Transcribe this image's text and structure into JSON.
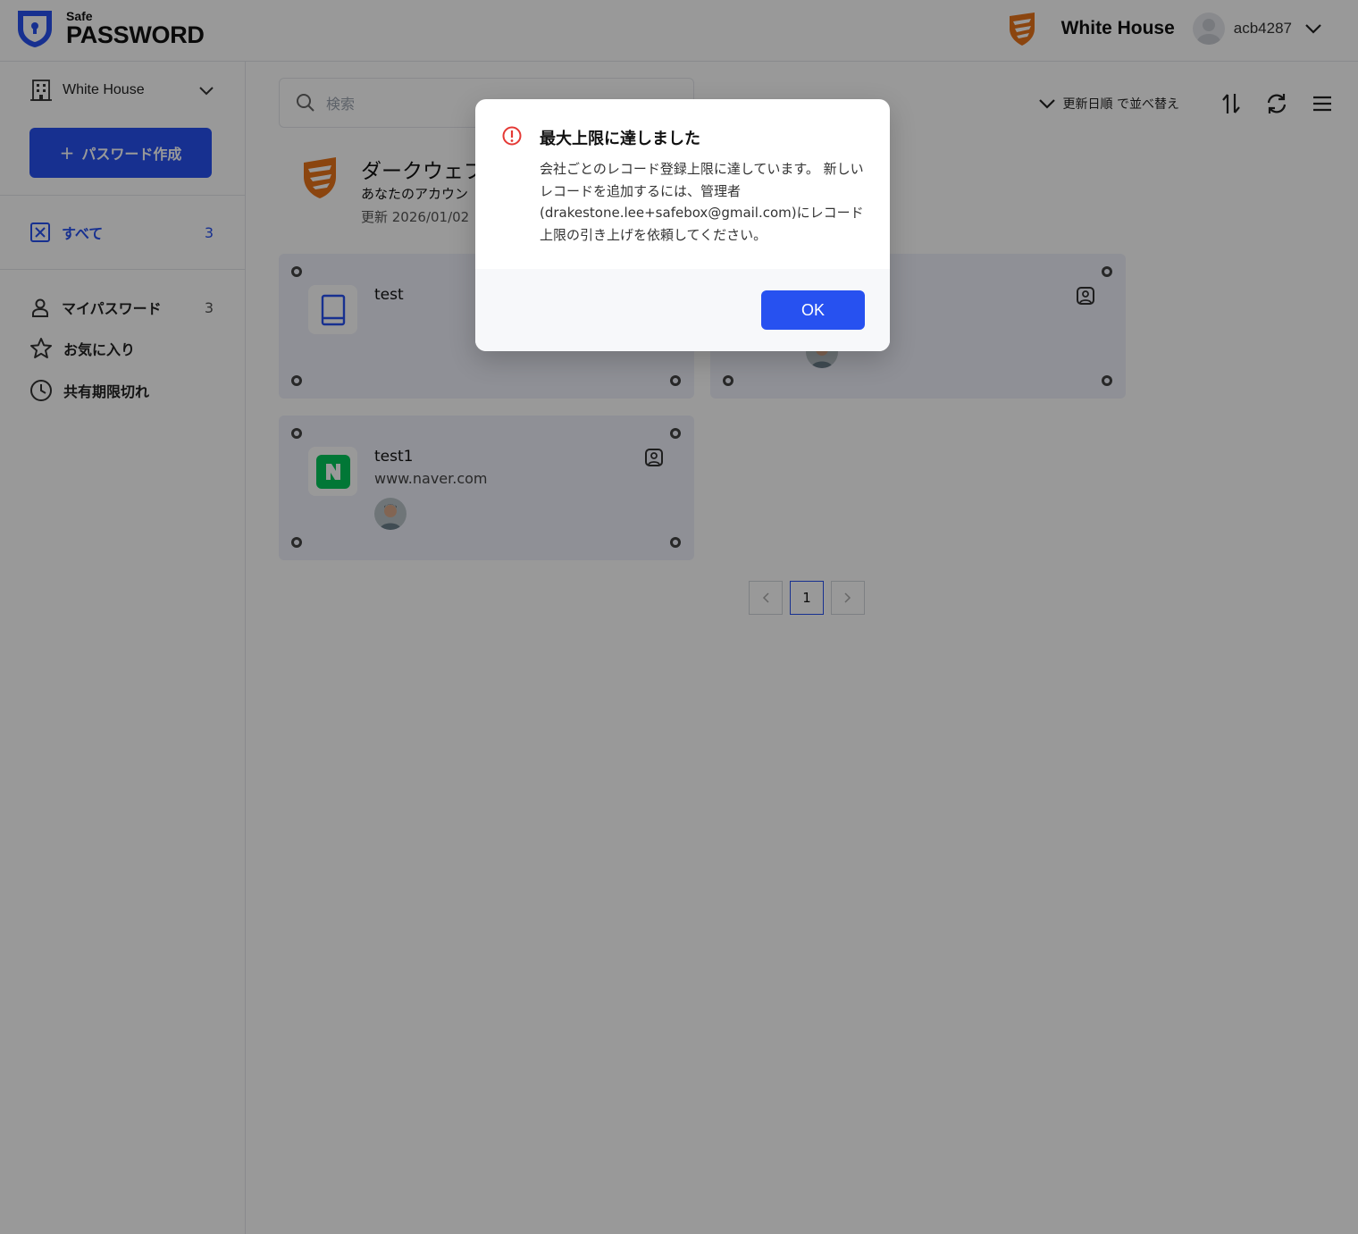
{
  "header": {
    "logo_small": "Safe",
    "logo_big": "PASSWORD",
    "company": "White House",
    "username": "acb4287"
  },
  "sidebar": {
    "company_select": "White House",
    "create_button": "パスワード作成",
    "all": {
      "label": "すべて",
      "count": "3"
    },
    "items": [
      {
        "label": "マイパスワード",
        "count": "3"
      },
      {
        "label": "お気に入り",
        "count": ""
      },
      {
        "label": "共有期限切れ",
        "count": ""
      }
    ]
  },
  "search": {
    "placeholder": "検索"
  },
  "toolbar": {
    "sort_label": "更新日順 で並べ替え"
  },
  "dark_web": {
    "title": "ダークウェブ",
    "subtitle": "あなたのアカウン",
    "date": "更新 2026/01/02"
  },
  "cards": [
    {
      "title": "test",
      "url": ""
    },
    {
      "title": "",
      "url": ""
    },
    {
      "title": "test1",
      "url": "www.naver.com"
    }
  ],
  "pagination": {
    "current": "1"
  },
  "modal": {
    "title": "最大上限に達しました",
    "body": "会社ごとのレコード登録上限に達しています。 新しいレコードを追加するには、管理者(drakestone.lee+safebox@gmail.com)にレコード上限の引き上げを依頼してください。",
    "ok": "OK"
  },
  "colors": {
    "accent": "#2751f0",
    "warning": "#e53935",
    "brand_orange": "#e8731a"
  }
}
